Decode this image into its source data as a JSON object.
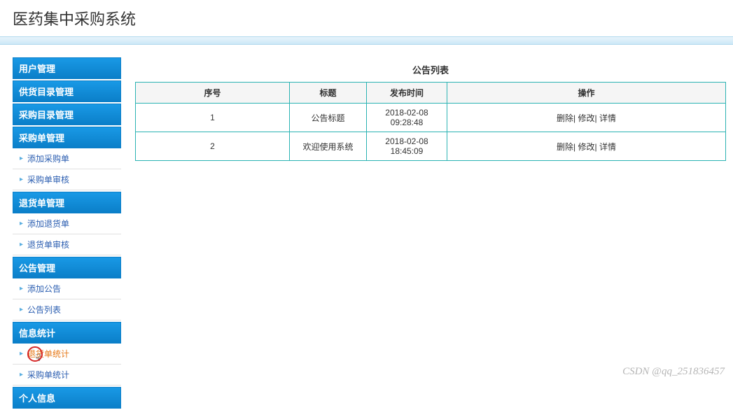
{
  "header": {
    "title": "医药集中采购系统"
  },
  "sidebar": {
    "groups": [
      {
        "header": "用户管理",
        "items": []
      },
      {
        "header": "供货目录管理",
        "items": []
      },
      {
        "header": "采购目录管理",
        "items": []
      },
      {
        "header": "采购单管理",
        "items": [
          {
            "label": "添加采购单"
          },
          {
            "label": "采购单审核"
          }
        ]
      },
      {
        "header": "退货单管理",
        "items": [
          {
            "label": "添加退货单"
          },
          {
            "label": "退货单审核"
          }
        ]
      },
      {
        "header": "公告管理",
        "items": [
          {
            "label": "添加公告"
          },
          {
            "label": "公告列表"
          }
        ]
      },
      {
        "header": "信息统计",
        "items": [
          {
            "label": "退货单统计",
            "active": true
          },
          {
            "label": "采购单统计"
          }
        ]
      },
      {
        "header": "个人信息",
        "items": []
      }
    ]
  },
  "main": {
    "table_title": "公告列表",
    "columns": {
      "sn": "序号",
      "title": "标题",
      "time": "发布时间",
      "action": "操作"
    },
    "actions": {
      "delete": "删除",
      "edit": "修改",
      "detail": "详情",
      "sep": "| "
    },
    "rows": [
      {
        "sn": "1",
        "title": "公告标题",
        "time": "2018-02-08 09:28:48"
      },
      {
        "sn": "2",
        "title": "欢迎使用系统",
        "time": "2018-02-08 18:45:09"
      }
    ]
  },
  "watermark": "CSDN @qq_251836457"
}
